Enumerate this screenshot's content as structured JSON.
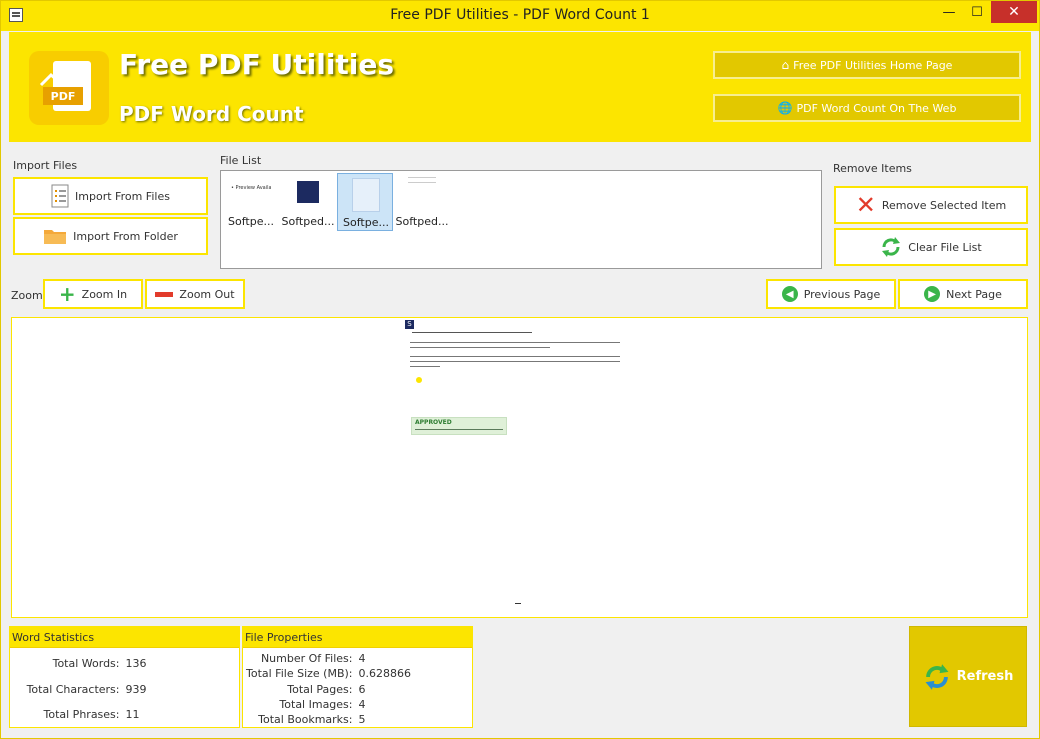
{
  "window": {
    "title": "Free PDF Utilities - PDF Word Count 1"
  },
  "header": {
    "title": "Free PDF Utilities",
    "subtitle": "PDF Word Count",
    "logo_text": "PDF",
    "home_button": "Free PDF Utilities Home Page",
    "web_button": "PDF Word Count On The Web"
  },
  "import": {
    "label": "Import Files",
    "from_files": "Import From Files",
    "from_folder": "Import From Folder"
  },
  "file_list": {
    "label": "File List",
    "items": [
      {
        "label": "Softpe...",
        "thumb_text": "• Preview Availabl"
      },
      {
        "label": "Softped...",
        "thumb_text": ""
      },
      {
        "label": "Softpe...",
        "thumb_text": ""
      },
      {
        "label": "Softped...",
        "thumb_text": ""
      }
    ],
    "selected_index": 2
  },
  "remove": {
    "label": "Remove Items",
    "remove_selected": "Remove Selected Item",
    "clear_list": "Clear File List"
  },
  "zoom": {
    "label": "Zoom:",
    "zoom_in": "Zoom In",
    "zoom_out": "Zoom Out"
  },
  "paging": {
    "previous": "Previous Page",
    "next": "Next Page"
  },
  "preview": {
    "page_letter": "S",
    "stamp_text": "APPROVED"
  },
  "word_stats": {
    "label": "Word Statistics",
    "rows": [
      {
        "key": "Total Words:",
        "value": "136"
      },
      {
        "key": "Total Characters:",
        "value": "939"
      },
      {
        "key": "Total Phrases:",
        "value": "11"
      }
    ]
  },
  "file_props": {
    "label": "File Properties",
    "rows": [
      {
        "key": "Number Of Files:",
        "value": "4"
      },
      {
        "key": "Total File Size (MB):",
        "value": "0.628866"
      },
      {
        "key": "Total Pages:",
        "value": "6"
      },
      {
        "key": "Total Images:",
        "value": "4"
      },
      {
        "key": "Total Bookmarks:",
        "value": "5"
      }
    ]
  },
  "refresh": {
    "label": "Refresh"
  },
  "colors": {
    "accent": "#fce500",
    "accent_dark": "#e2c800",
    "close": "#c7302a"
  }
}
